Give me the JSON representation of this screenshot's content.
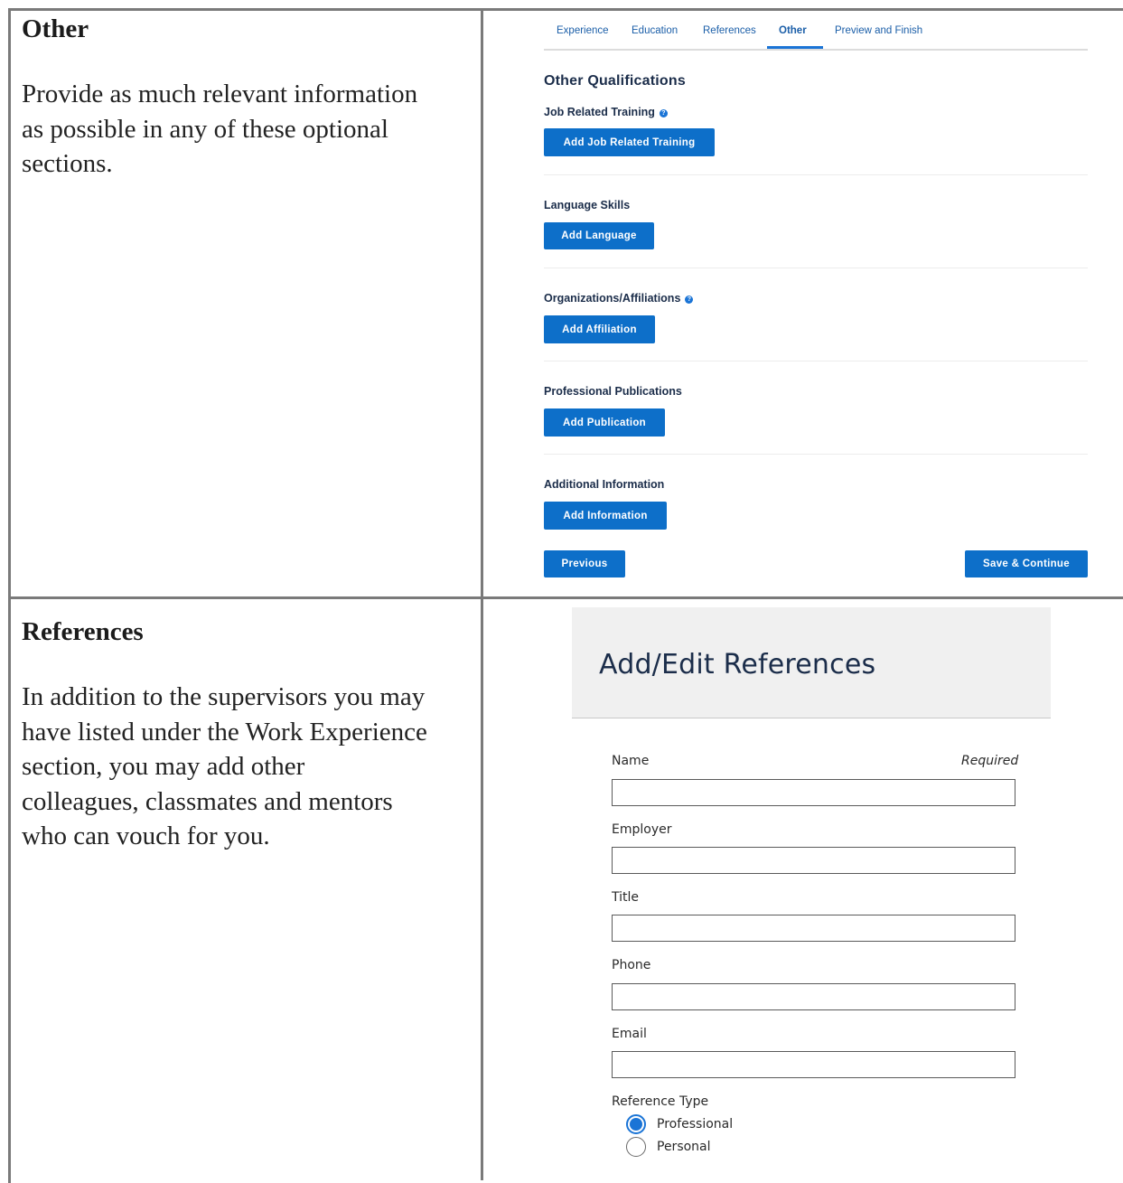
{
  "other_section": {
    "title": "Other",
    "description": "Provide as much relevant information as possible in any of these optional sections."
  },
  "references_section": {
    "title": "References",
    "description": "In addition to the supervisors you may have listed under the Work Experience section, you may add other colleagues, classmates and mentors who can vouch for you."
  },
  "other_panel": {
    "tabs": [
      {
        "label": "Experience"
      },
      {
        "label": "Education"
      },
      {
        "label": "References"
      },
      {
        "label": "Other",
        "active": true
      },
      {
        "label": "Preview and Finish"
      }
    ],
    "heading": "Other Qualifications",
    "sections": [
      {
        "label": "Job Related Training",
        "has_info": true,
        "button": "Add Job Related Training"
      },
      {
        "label": "Language Skills",
        "has_info": false,
        "button": "Add Language"
      },
      {
        "label": "Organizations/Affiliations",
        "has_info": true,
        "button": "Add Affiliation"
      },
      {
        "label": "Professional Publications",
        "has_info": false,
        "button": "Add Publication"
      },
      {
        "label": "Additional Information",
        "has_info": false,
        "button": "Add Information"
      }
    ],
    "previous_button": "Previous",
    "save_button": "Save & Continue"
  },
  "references_form": {
    "title": "Add/Edit References",
    "required_label": "Required",
    "fields": [
      {
        "label": "Name",
        "value": ""
      },
      {
        "label": "Employer",
        "value": ""
      },
      {
        "label": "Title",
        "value": ""
      },
      {
        "label": "Phone",
        "value": ""
      },
      {
        "label": "Email",
        "value": ""
      }
    ],
    "reference_type_label": "Reference Type",
    "reference_type_options": [
      {
        "label": "Professional",
        "selected": true
      },
      {
        "label": "Personal",
        "selected": false
      }
    ]
  },
  "colors": {
    "button": "#0d6fc9",
    "heading": "#1b2d4a",
    "link": "#1a5ea8",
    "border": "#7a7a7a"
  }
}
